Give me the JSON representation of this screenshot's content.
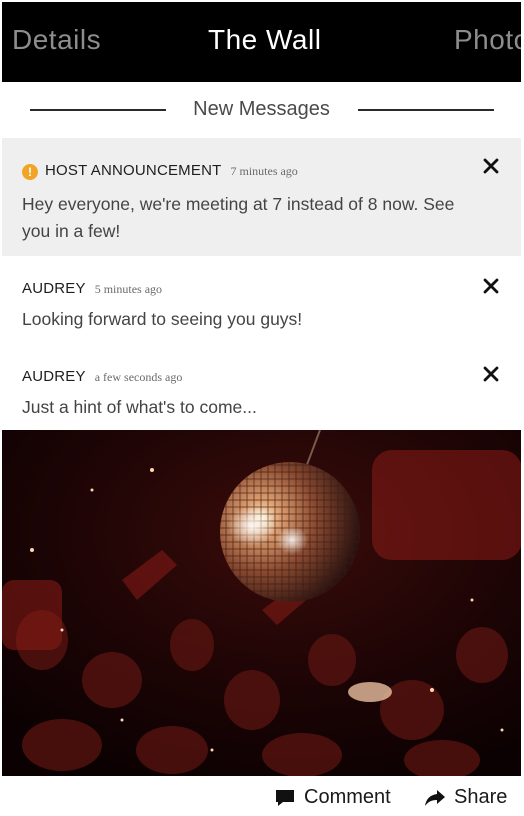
{
  "tabs": {
    "left": "Details",
    "center": "The Wall",
    "right": "Photos"
  },
  "divider": {
    "label": "New Messages"
  },
  "messages": [
    {
      "author": "HOST ANNOUNCEMENT",
      "time": "7 minutes ago",
      "text": "Hey everyone, we're meeting at 7 instead of 8 now. See you in a few!",
      "highlighted": true,
      "badge": "!"
    },
    {
      "author": "AUDREY",
      "time": "5 minutes ago",
      "text": "Looking forward to seeing you guys!"
    },
    {
      "author": "AUDREY",
      "time": "a few seconds ago",
      "text": "Just a hint of what's to come..."
    }
  ],
  "actions": {
    "comment": "Comment",
    "share": "Share"
  },
  "colors": {
    "tabbar": "#000000",
    "announce_bg": "#efefef",
    "badge": "#f0a526"
  },
  "icons": {
    "close": "close-icon",
    "comment": "comment-icon",
    "share": "share-icon",
    "alert": "alert-icon"
  }
}
